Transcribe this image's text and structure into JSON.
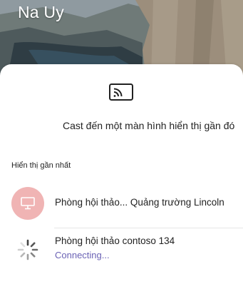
{
  "header": {
    "title": "Na Uy"
  },
  "cast": {
    "icon": "cast-icon",
    "caption": "Cast đến một màn hình hiển thị gần đó"
  },
  "recent": {
    "section_label": "Hiển thị gần nhất",
    "devices": [
      {
        "name": "Phòng hội thảo... Quảng trường Lincoln",
        "icon": "monitor-icon",
        "avatar_color": "#f0b4b4"
      },
      {
        "name": "Phòng hội thảo contoso 134",
        "status": "Connecting...",
        "status_color": "#6b63b5",
        "icon": "loading-spinner-icon"
      }
    ]
  }
}
